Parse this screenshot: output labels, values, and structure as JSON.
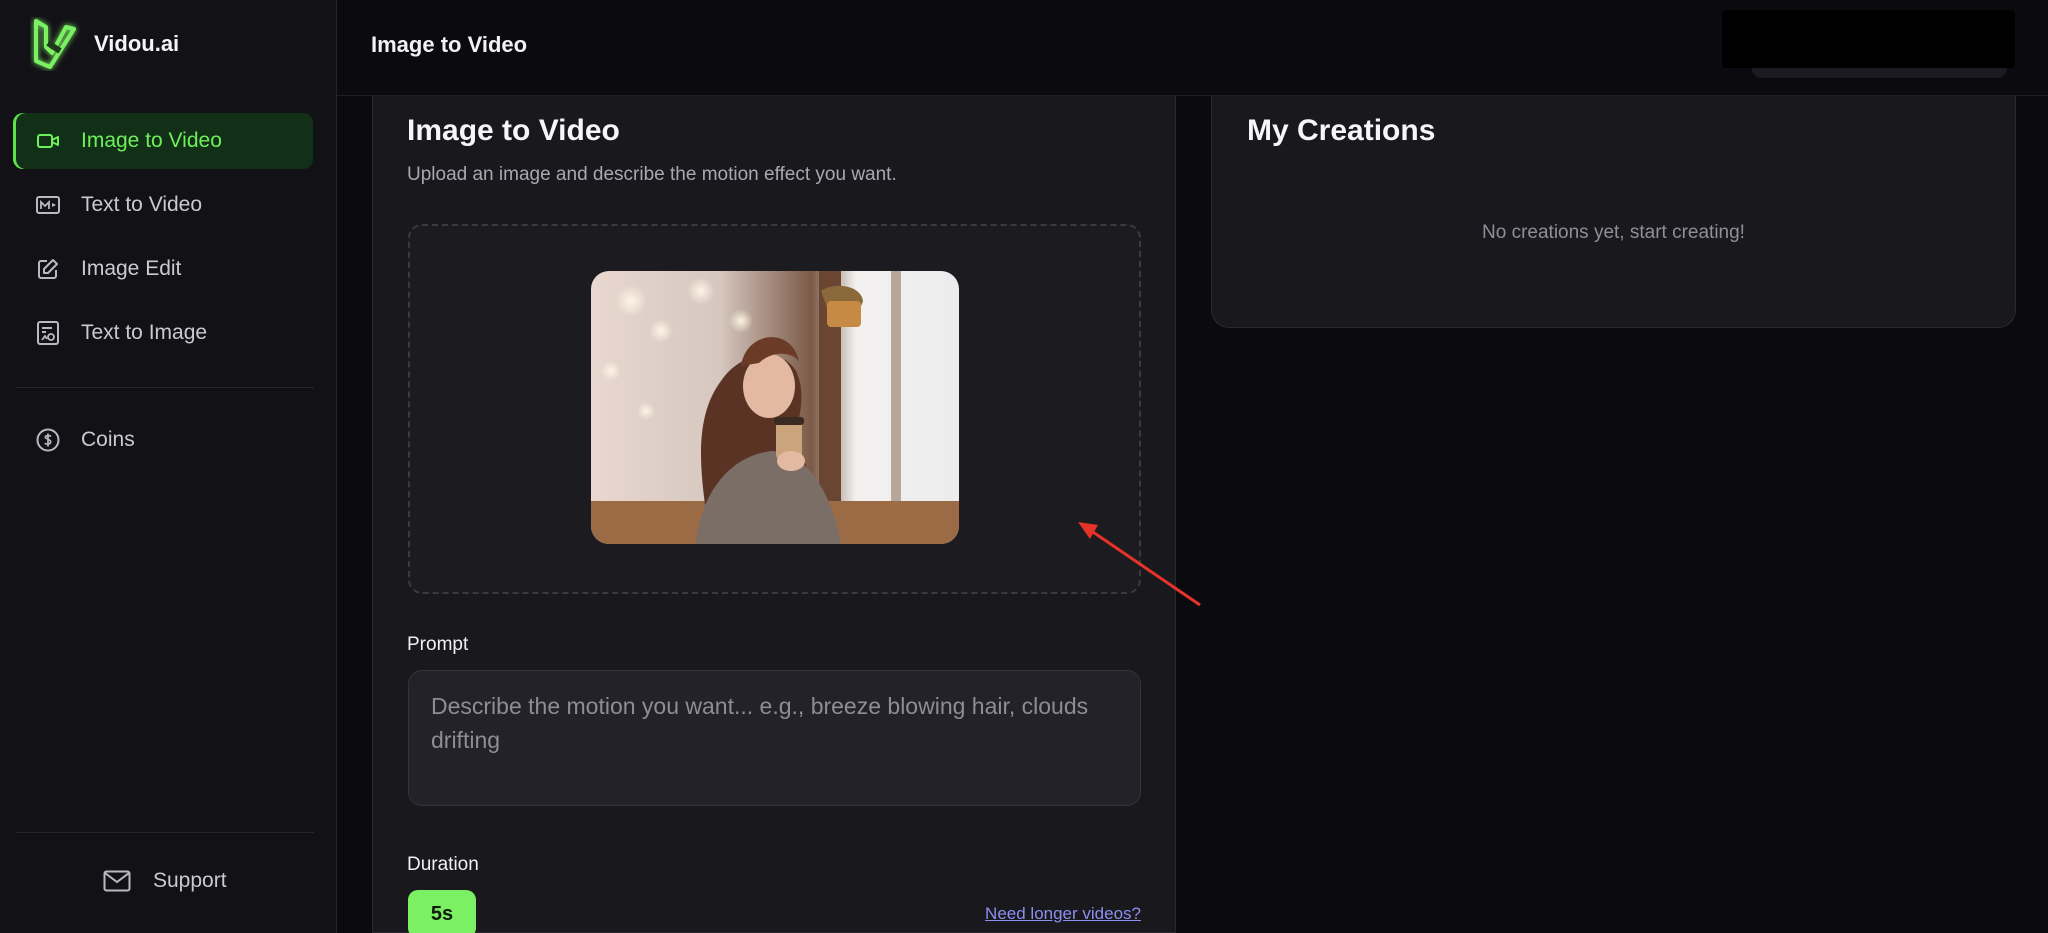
{
  "brand": {
    "name": "Vidou.ai",
    "accent": "#6df05a"
  },
  "sidebar": {
    "items": [
      {
        "label": "Image to Video",
        "icon": "video-camera-icon",
        "active": true
      },
      {
        "label": "Text to Video",
        "icon": "film-icon",
        "active": false
      },
      {
        "label": "Image Edit",
        "icon": "edit-icon",
        "active": false
      },
      {
        "label": "Text to Image",
        "icon": "image-text-icon",
        "active": false
      }
    ],
    "coins": {
      "label": "Coins",
      "icon": "coin-icon"
    },
    "support": {
      "label": "Support",
      "icon": "mail-icon"
    }
  },
  "header": {
    "title": "Image to Video"
  },
  "main": {
    "title": "Image to Video",
    "subtitle": "Upload an image and describe the motion effect you want.",
    "prompt_label": "Prompt",
    "prompt_placeholder": "Describe the motion you want... e.g., breeze blowing hair, clouds drifting",
    "duration_label": "Duration",
    "duration_value": "5s",
    "longer_link": "Need longer videos?"
  },
  "creations": {
    "title": "My Creations",
    "empty_text": "No creations yet, start creating!"
  }
}
